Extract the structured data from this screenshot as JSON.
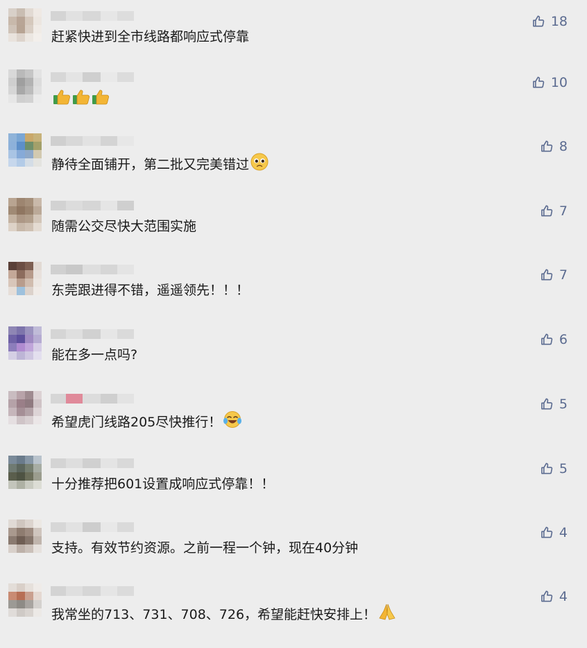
{
  "comments": [
    {
      "text": "赶紧快进到全市线路都响应式停靠",
      "likes": "18",
      "emoji": [],
      "avatar": [
        "#d8d0c8",
        "#c9bdb2",
        "#e2dad3",
        "#efe9e4",
        "#c8b9ab",
        "#b8a596",
        "#d5c8bc",
        "#ece6e0",
        "#cfc3b8",
        "#b7a494",
        "#d9cec4",
        "#f0ebe6",
        "#e9e3dd",
        "#ddd4cc",
        "#ece7e2",
        "#f3efeb"
      ],
      "nick": [
        "#d4d4d4",
        "#e1e1e1",
        "#d8d8d8",
        "#e6e6e6",
        "#dddddd"
      ]
    },
    {
      "text": "",
      "likes": "10",
      "emoji": [
        "thumbs-up-emoji",
        "thumbs-up-emoji",
        "thumbs-up-emoji"
      ],
      "avatar": [
        "#d9d9d9",
        "#b9b9b9",
        "#c5c5c5",
        "#e3e3e3",
        "#cfcfcf",
        "#9f9f9f",
        "#b2b2b2",
        "#dcdcdc",
        "#d6d6d6",
        "#a8a8a8",
        "#bcbcbc",
        "#e0e0e0",
        "#e6e6e6",
        "#cfcfcf",
        "#d2d2d2",
        "#ebebeb"
      ],
      "nick": [
        "#d7d7d7",
        "#e4e4e4",
        "#cfcfcf",
        "#e9e9e9",
        "#dcdcdc"
      ]
    },
    {
      "text": "静待全面铺开，第二批又完美错过",
      "likes": "8",
      "emoji": [
        "pleading-face-emoji"
      ],
      "avatar": [
        "#8fb3d9",
        "#7aa6d4",
        "#c9a86a",
        "#c7b27a",
        "#8db1da",
        "#5d8fc9",
        "#6f8f6b",
        "#a3a06a",
        "#a9c4e4",
        "#86aad8",
        "#8fa9c9",
        "#d2c9b0",
        "#c6d7ec",
        "#b3cbe7",
        "#d4dde6",
        "#e4e4e0"
      ],
      "nick": [
        "#cfcfcf",
        "#d8d8d8",
        "#e2e2e2",
        "#d4d4d4",
        "#e7e7e7"
      ]
    },
    {
      "text": "随需公交尽快大范围实施",
      "likes": "7",
      "emoji": [],
      "avatar": [
        "#b8a491",
        "#9d8570",
        "#a58f7a",
        "#c9b9aa",
        "#a08a75",
        "#8f7661",
        "#9a836e",
        "#bba998",
        "#c4b3a2",
        "#ad9886",
        "#b29f8c",
        "#d2c5b8",
        "#ddd2c7",
        "#c8b9aa",
        "#cfc1b3",
        "#e4dbd2"
      ],
      "nick": [
        "#d2d2d2",
        "#dcdcdc",
        "#d6d6d6",
        "#e5e5e5",
        "#cfcfcf"
      ]
    },
    {
      "text": "东莞跟进得不错，遥遥领先！！！",
      "likes": "7",
      "emoji": [],
      "avatar": [
        "#5a4038",
        "#6b4e44",
        "#7d5f52",
        "#e2dad4",
        "#c4a898",
        "#8c6c5d",
        "#b69a8a",
        "#e8e1dc",
        "#d8c6ba",
        "#b89c8c",
        "#d0bcae",
        "#ece6e1",
        "#e6ded8",
        "#9ec1dd",
        "#dcd2cb",
        "#f0ebe7"
      ],
      "nick": [
        "#d0d0d0",
        "#c8c8c8",
        "#dedede",
        "#d6d6d6",
        "#e4e4e4"
      ]
    },
    {
      "text": "能在多一点吗?",
      "likes": "6",
      "emoji": [],
      "avatar": [
        "#8e86b4",
        "#7d74ab",
        "#9b93bf",
        "#c0bbd8",
        "#6f62a6",
        "#5d4f9c",
        "#a08ac2",
        "#b6acd2",
        "#8c7dbb",
        "#b08bd0",
        "#c0a5da",
        "#d6cde6",
        "#d4cfe4",
        "#bdb5d6",
        "#cfc7e1",
        "#e3dfee"
      ],
      "nick": [
        "#d5d5d5",
        "#dfdfdf",
        "#d1d1d1",
        "#e6e6e6",
        "#dadada"
      ]
    },
    {
      "text": "希望虎门线路205尽快推行！",
      "likes": "5",
      "emoji": [
        "laughing-crying-face-emoji"
      ],
      "avatar": [
        "#c9bcc0",
        "#b8a3a9",
        "#9f8b90",
        "#dcd2d4",
        "#b5a2a8",
        "#9a7f88",
        "#8f7a80",
        "#cfc3c6",
        "#c6b6bb",
        "#a58f96",
        "#b3a2a7",
        "#ddd4d6",
        "#e5dfe1",
        "#cfc4c7",
        "#d8cfd1",
        "#ebe6e7"
      ],
      "nick": [
        "#d6d6d6",
        "#e08a9a",
        "#dcdcdc",
        "#cfcfcf",
        "#e3e3e3"
      ]
    },
    {
      "text": "十分推荐把601设置成响应式停靠！！",
      "likes": "5",
      "emoji": [],
      "avatar": [
        "#7a8a99",
        "#6a7b8b",
        "#8797a6",
        "#b9c3cc",
        "#6f7a72",
        "#5c665d",
        "#767f71",
        "#a7ada4",
        "#5a5e4c",
        "#4e5343",
        "#6b6e5a",
        "#9b9d8e",
        "#c3c5bb",
        "#aeb1a4",
        "#c9cbc1",
        "#dcddd5"
      ],
      "nick": [
        "#d4d4d4",
        "#dedede",
        "#d0d0d0",
        "#e4e4e4",
        "#d9d9d9"
      ]
    },
    {
      "text": "支持。有效节约资源。之前一程一个钟，现在40分钟",
      "likes": "4",
      "emoji": [],
      "avatar": [
        "#e0dad5",
        "#cfc6bf",
        "#dcd4ce",
        "#ece8e4",
        "#a9998e",
        "#8e7c70",
        "#9d8b80",
        "#cfc5be",
        "#8a7a70",
        "#6f5e54",
        "#85756b",
        "#c0b5ad",
        "#d8d0ca",
        "#bdb1a9",
        "#cac0b9",
        "#e6e1dd"
      ],
      "nick": [
        "#d7d7d7",
        "#e2e2e2",
        "#cdcdcd",
        "#e8e8e8",
        "#dadada"
      ]
    },
    {
      "text": "我常坐的713、731、708、726，希望能赶快安排上！",
      "likes": "4",
      "emoji": [
        "folded-hands-emoji"
      ],
      "avatar": [
        "#e3ddd8",
        "#d9cfc8",
        "#e6e0db",
        "#efebe8",
        "#c98b73",
        "#b76f55",
        "#c9a08f",
        "#e5d9d2",
        "#9c9a95",
        "#8e8b86",
        "#a8a4a0",
        "#d4d1ce",
        "#e0dcd9",
        "#cfcac6",
        "#d9d4d0",
        "#ece9e6"
      ],
      "nick": [
        "#d3d3d3",
        "#dfdfdf",
        "#d6d6d6",
        "#e5e5e5",
        "#dbdbdb"
      ]
    }
  ]
}
